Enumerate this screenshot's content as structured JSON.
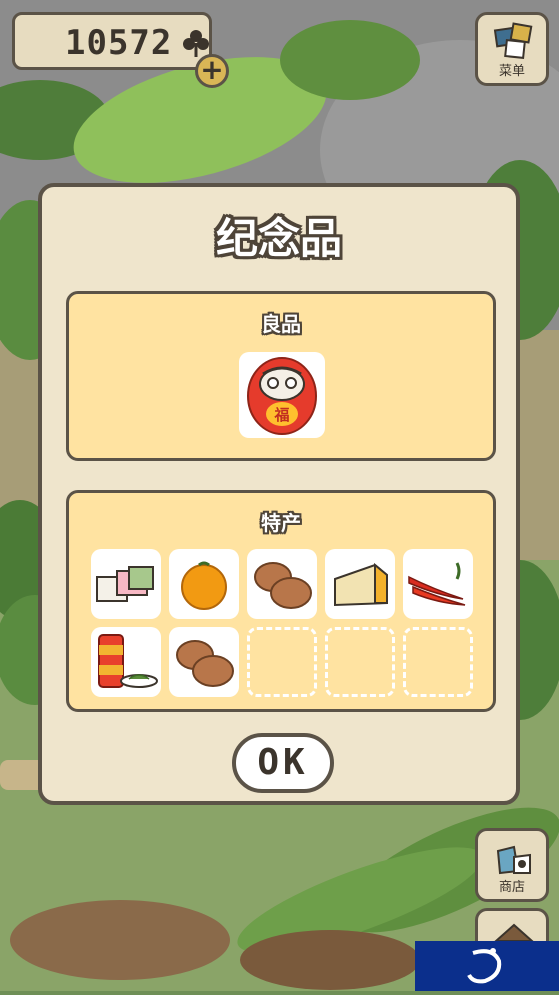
{
  "hud": {
    "clover_count": "10572",
    "clover_icon": "clover-icon",
    "add_icon": "plus",
    "menu_label": "菜单",
    "shop_label": "商店"
  },
  "modal": {
    "title": "纪念品",
    "ok_label": "OK",
    "sections": [
      {
        "title": "良品",
        "items": [
          {
            "icon": "daruma-icon",
            "caption_char": "福"
          }
        ]
      },
      {
        "title": "特产",
        "items": [
          {
            "icon": "kashiwa-mochi-icon"
          },
          {
            "icon": "mandarin-orange-icon"
          },
          {
            "icon": "manju-buns-icon"
          },
          {
            "icon": "cheese-icon"
          },
          {
            "icon": "chili-peppers-icon"
          },
          {
            "icon": "tea-can-icon"
          },
          {
            "icon": "manju-buns-icon"
          },
          {
            "icon": "empty-slot"
          },
          {
            "icon": "empty-slot"
          },
          {
            "icon": "empty-slot"
          }
        ]
      }
    ]
  },
  "colors": {
    "panel_fill": "#ffe3a1",
    "modal_fill": "#efe5cc",
    "outline": "#5b5347"
  }
}
